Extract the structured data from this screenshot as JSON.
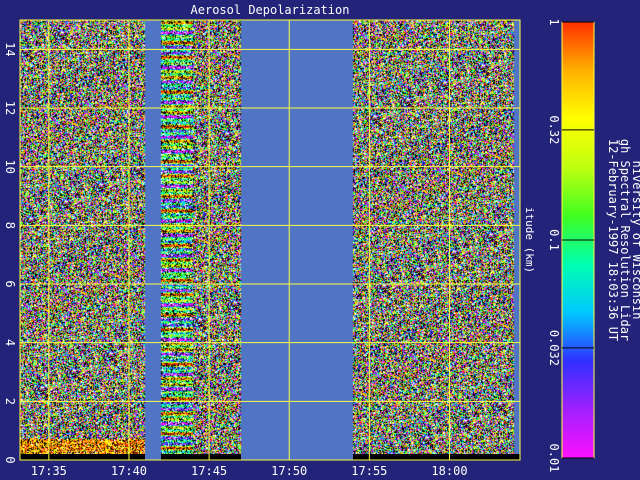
{
  "chart_data": {
    "type": "heatmap",
    "title": "Aerosol Depolarization",
    "xlabel": "",
    "ylabel": "itude (km)",
    "x_tick_labels": [
      "17:35",
      "17:40",
      "17:45",
      "17:50",
      "17:55",
      "18:00"
    ],
    "y_ticks": [
      0,
      2,
      4,
      6,
      8,
      10,
      12,
      14
    ],
    "ylim": [
      0,
      15
    ],
    "grid": true,
    "color_scale": {
      "type": "log",
      "range": [
        0.01,
        1
      ],
      "tick_labels": [
        "0.01",
        "0.032",
        "0.1",
        "0.32",
        "1"
      ]
    },
    "data_segments": [
      {
        "time_start": "17:33",
        "time_end": "17:41",
        "content": "noisy depolarization"
      },
      {
        "time_start": "17:41",
        "time_end": "17:42",
        "content": "no data"
      },
      {
        "time_start": "17:42",
        "time_end": "17:44",
        "content": "banded depolarization"
      },
      {
        "time_start": "17:44",
        "time_end": "17:47",
        "content": "noisy depolarization"
      },
      {
        "time_start": "17:47",
        "time_end": "17:54",
        "content": "no data"
      },
      {
        "time_start": "17:54",
        "time_end": "18:04",
        "content": "noisy depolarization"
      }
    ],
    "attribution": [
      "niversity of Wisconsin",
      "gh Spectral Resolution Lidar",
      "12-February-1997 18:03:36 UT"
    ]
  },
  "colors": {
    "background": "#23237a",
    "no_data": "#4f75c4",
    "grid": "#ffff40",
    "text": "#ffffff",
    "colormap": [
      "#ff10ff",
      "#a020ff",
      "#3030ff",
      "#00c8ff",
      "#00ffb0",
      "#40ff20",
      "#c0ff10",
      "#ffff00",
      "#ffb000",
      "#ff3000"
    ]
  }
}
